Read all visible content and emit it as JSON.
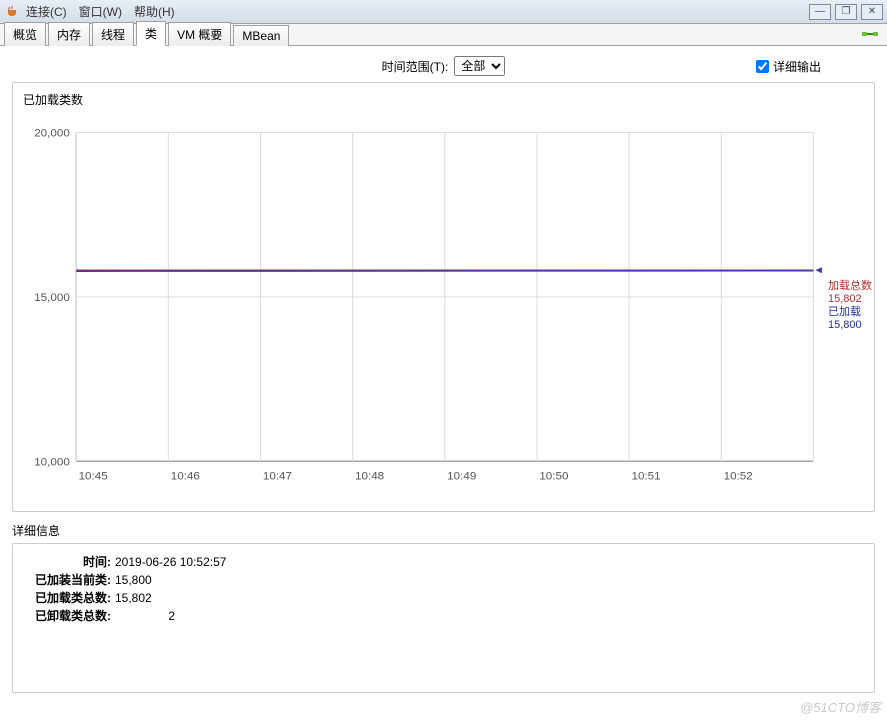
{
  "titlebar": {
    "menu": {
      "connect": "连接(C)",
      "window": "窗口(W)",
      "help": "帮助(H)"
    }
  },
  "tabs": [
    "概览",
    "内存",
    "线程",
    "类",
    "VM 概要",
    "MBean"
  ],
  "active_tab": "类",
  "controls": {
    "time_range_label": "时间范围(T):",
    "time_range_value": "全部",
    "detail_output_label": "详细输出",
    "detail_output_checked": true
  },
  "chart_data": {
    "type": "line",
    "title": "已加载类数",
    "xlabel": "",
    "ylabel": "",
    "y_ticks": [
      10000,
      15000,
      20000
    ],
    "y_tick_labels": [
      "10,000",
      "15,000",
      "20,000"
    ],
    "ylim": [
      10000,
      20000
    ],
    "x_ticks": [
      "10:45",
      "10:46",
      "10:47",
      "10:48",
      "10:49",
      "10:50",
      "10:51",
      "10:52"
    ],
    "series": [
      {
        "name": "已加载",
        "label": "已加载",
        "value_label": "15,800",
        "color": "#3a3ab0",
        "values": [
          15800,
          15800,
          15800,
          15800,
          15800,
          15800,
          15800,
          15800
        ]
      },
      {
        "name": "加载总数",
        "label": "加载总数",
        "value_label": "15,802",
        "color": "#b03333",
        "values": [
          15802,
          15802,
          15802,
          15802,
          15802,
          15802,
          15802,
          15802
        ]
      }
    ]
  },
  "details": {
    "heading": "详细信息",
    "rows": {
      "time_label": "时间:",
      "time_value": "2019-06-26 10:52:57",
      "loaded_current_label": "已加装当前类:",
      "loaded_current_value": "15,800",
      "loaded_total_label": "已加载类总数:",
      "loaded_total_value": "15,802",
      "unloaded_total_label": "已卸载类总数:",
      "unloaded_total_value": "2"
    }
  },
  "watermark": "@51CTO博客"
}
